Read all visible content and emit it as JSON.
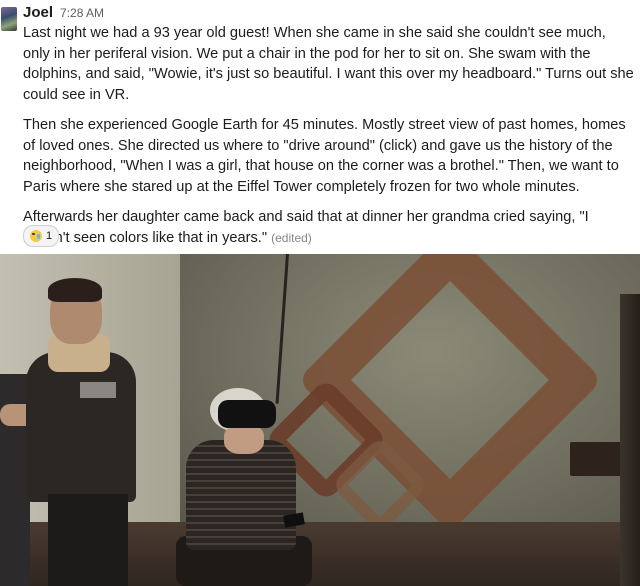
{
  "message": {
    "author": "Joel",
    "time": "7:28 AM",
    "paragraphs": [
      "Last night we had a 93 year old guest! When she came in she said she couldn't see much, only in her periferal vision. We put a chair in the pod for her to sit on. She swam with the dolphins, and said, \"Wowie, it's just so beautiful. I want this over my headboard.\" Turns out she could see in VR.",
      "Then she experienced Google Earth for 45 minutes. Mostly street view of past homes, homes of loved ones. She directed us where to \"drive around\" (click) and gave us the history of the neighborhood, \"When I was a girl, that house on the corner was a brothel.\" Then, we want to Paris where she stared up at the Eiffel Tower completely frozen for two whole minutes.",
      "Afterwards her daughter came back and said that at dinner her grandma cried saying, \"I haven't seen colors like that in years.\""
    ],
    "edited_label": "(edited)",
    "reaction": {
      "emoji_icon": "crying-joy-emoji-icon",
      "count": "1"
    }
  },
  "photo": {
    "icon": "photo-attachment"
  }
}
